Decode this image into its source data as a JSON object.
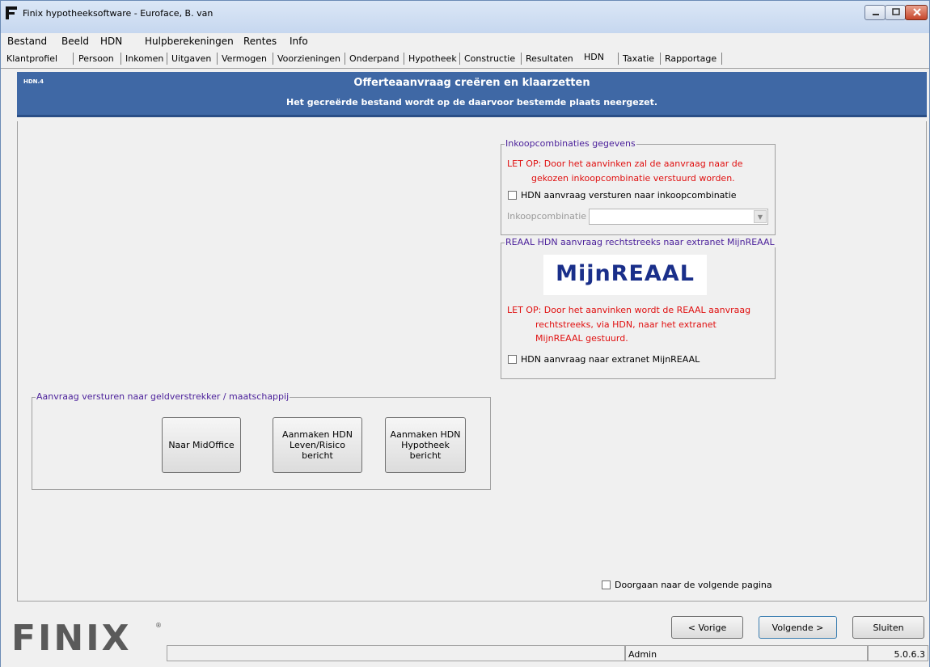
{
  "window": {
    "title": "Finix hypotheeksoftware - Euroface, B. van",
    "app_icon_letter": "F"
  },
  "menu": [
    "Bestand",
    "Beeld",
    "HDN",
    "Hulpberekeningen",
    "Rentes",
    "Info"
  ],
  "tabs": [
    "Klantprofiel",
    "Persoon",
    "Inkomen",
    "Uitgaven",
    "Vermogen",
    "Voorzieningen",
    "Onderpand",
    "Hypotheek",
    "Constructie",
    "Resultaten",
    "HDN",
    "Taxatie",
    "Rapportage"
  ],
  "active_tab": "HDN",
  "header": {
    "code": "HDN.4",
    "title": "Offerteaanvraag creëren en klaarzetten",
    "subtitle": "Het gecreërde bestand wordt op de daarvoor bestemde plaats neergezet."
  },
  "inkoop": {
    "legend": "Inkoopcombinaties gegevens",
    "warning_line1": "LET OP: Door  het aanvinken zal de aanvraag naar de",
    "warning_line2": "gekozen inkoopcombinatie verstuurd worden.",
    "checkbox_label": "HDN aanvraag versturen naar inkoopcombinatie",
    "checkbox_checked": false,
    "combo_label": "Inkoopcombinatie",
    "combo_value": ""
  },
  "reaal": {
    "legend": "REAAL HDN aanvraag rechtstreeks naar extranet MijnREAAL",
    "logo_text": "MijnREAAL",
    "warning_line1": "LET OP: Door  het aanvinken wordt de REAAL aanvraag",
    "warning_line2": "rechtstreeks, via HDN, naar het extranet",
    "warning_line3": "MijnREAAL gestuurd.",
    "checkbox_label": "HDN aanvraag naar extranet MijnREAAL",
    "checkbox_checked": false
  },
  "send": {
    "legend": "Aanvraag versturen naar geldverstrekker / maatschappij",
    "btn_midoffice": "Naar MidOffice",
    "btn_leven": "Aanmaken HDN\nLeven/Risico\nbericht",
    "btn_hypotheek": "Aanmaken HDN\nHypotheek\nbericht"
  },
  "next_page": {
    "checkbox_label": "Doorgaan naar de volgende pagina",
    "checked": false
  },
  "footer": {
    "logo": "FINIX",
    "logo_reg": "®",
    "btn_prev": "< Vorige",
    "btn_next": "Volgende >",
    "btn_close": "Sluiten",
    "status_left": "",
    "status_user": "Admin",
    "version": "5.0.6.3"
  },
  "colors": {
    "header_band": "#3f68a5",
    "legend_text": "#4a1f9a",
    "warning_text": "#e01010",
    "reaal_logo": "#1a2f8a"
  }
}
